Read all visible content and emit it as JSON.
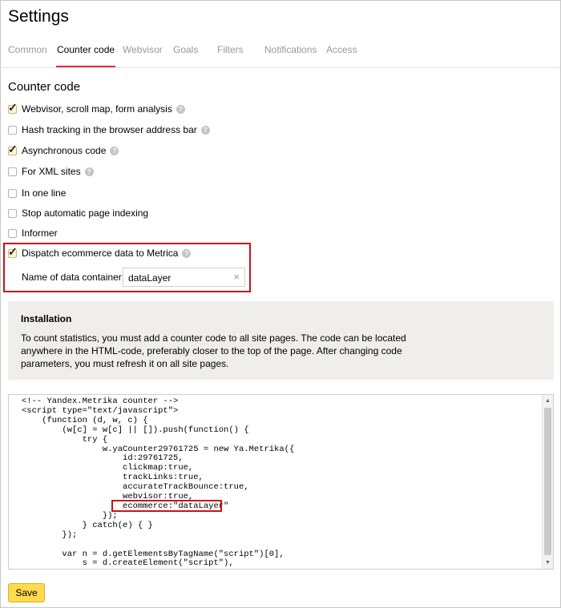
{
  "page": {
    "title": "Settings"
  },
  "tabs": [
    {
      "label": "Common",
      "active": false
    },
    {
      "label": "Counter code",
      "active": true
    },
    {
      "label": "Webvisor",
      "active": false
    },
    {
      "label": "Goals",
      "active": false
    },
    {
      "label": "Filters",
      "active": false
    },
    {
      "label": "Notifications",
      "active": false
    },
    {
      "label": "Access",
      "active": false
    }
  ],
  "counter_code": {
    "heading": "Counter code",
    "options": [
      {
        "label": "Webvisor, scroll map, form analysis",
        "checked": true,
        "help": true
      },
      {
        "label": "Hash tracking in the browser address bar",
        "checked": false,
        "help": true
      },
      {
        "label": "Asynchronous code",
        "checked": true,
        "help": true
      },
      {
        "label": "For XML sites",
        "checked": false,
        "help": true
      },
      {
        "label": "In one line",
        "checked": false,
        "help": false
      },
      {
        "label": "Stop automatic page indexing",
        "checked": false,
        "help": false
      },
      {
        "label": "Informer",
        "checked": false,
        "help": false
      },
      {
        "label": "Dispatch ecommerce data to Metrica",
        "checked": true,
        "help": true
      }
    ],
    "help_glyph": "?",
    "data_container": {
      "label": "Name of data container:",
      "value": "dataLayer",
      "clear_icon": "×"
    }
  },
  "installation": {
    "title": "Installation",
    "text": "To count statistics, you must add a counter code to all site pages. The code can be located anywhere in the HTML-code, preferably closer to the top of the page. After changing code parameters, you must refresh it on all site pages."
  },
  "code": {
    "lines": [
      "<!-- Yandex.Metrika counter -->",
      "<script type=\"text/javascript\">",
      "    (function (d, w, c) {",
      "        (w[c] = w[c] || []).push(function() {",
      "            try {",
      "                w.yaCounter29761725 = new Ya.Metrika({",
      "                    id:29761725,",
      "                    clickmap:true,",
      "                    trackLinks:true,",
      "                    accurateTrackBounce:true,",
      "                    webvisor:true,",
      "                    ecommerce:\"dataLayer\"",
      "                });",
      "            } catch(e) { }",
      "        });",
      "",
      "        var n = d.getElementsByTagName(\"script\")[0],",
      "            s = d.createElement(\"script\"),"
    ]
  },
  "scrollbar": {
    "up_icon": "▲",
    "down_icon": "▼"
  },
  "actions": {
    "save_label": "Save"
  },
  "colors": {
    "accent": "#e5283c",
    "highlight_border": "#d0101a",
    "save_button": "#ffdb4d",
    "panel_bg": "#efeeea"
  }
}
